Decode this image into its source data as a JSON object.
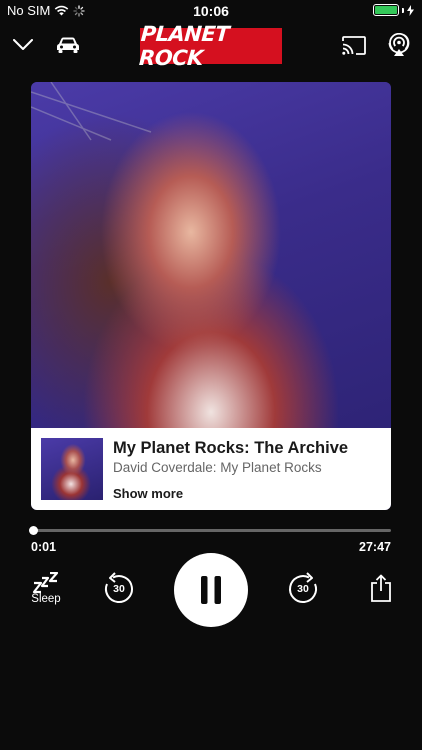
{
  "status_bar": {
    "carrier": "No SIM",
    "time": "10:06",
    "battery_color": "#34c759"
  },
  "header": {
    "logo_text": "PLANET ROCK",
    "brand_color": "#d5101f",
    "icons": [
      "chevron-down-icon",
      "car-icon",
      "cast-icon",
      "airplay-icon"
    ]
  },
  "episode": {
    "title": "My Planet Rocks: The Archive",
    "subtitle": "David Coverdale: My Planet Rocks",
    "show_more_label": "Show more"
  },
  "playback": {
    "elapsed": "0:01",
    "duration": "27:47",
    "progress_fraction": 0.0006
  },
  "controls": {
    "sleep_label": "Sleep",
    "rewind_seconds": "30",
    "forward_seconds": "30",
    "state": "playing"
  }
}
